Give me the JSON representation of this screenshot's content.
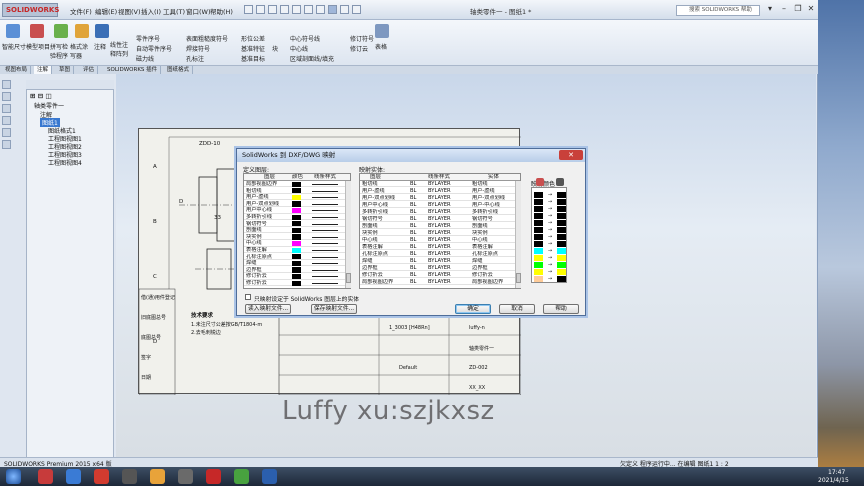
{
  "app": {
    "logo_text": "SOLIDWORKS",
    "menu": [
      "文件(F)",
      "编辑(E)",
      "视图(V)",
      "插入(I)",
      "工具(T)",
      "窗口(W)",
      "帮助(H)"
    ],
    "window_title": "轴类零件一 - 图纸1 *",
    "search_placeholder": "搜索 SOLIDWORKS 帮助"
  },
  "ribbon": {
    "big_buttons": [
      "智能尺寸",
      "模型项目",
      "拼写检验程序",
      "格式涂写器",
      "注释"
    ],
    "col1": [
      "线性注释阵列",
      "零件序号",
      "自动零件序号",
      "磁力线"
    ],
    "col2": [
      "表面粗糙度符号",
      "焊接符号",
      "孔标注"
    ],
    "col3": [
      "形位公差",
      "基准特征",
      "基准目标"
    ],
    "col4": [
      "中心符号线",
      "中心线",
      "区域剖面线/填充"
    ],
    "col5": [
      "修订符号",
      "修订云"
    ],
    "col6": [
      "表格"
    ],
    "col7": [
      "块"
    ]
  },
  "tabs": [
    "视图布局",
    "注解",
    "草图",
    "评估",
    "SOLIDWORKS 插件",
    "图纸格式"
  ],
  "tree": {
    "root": "轴类零件一",
    "items": [
      "注解",
      "图纸1",
      "图纸格式1",
      "工程图视图1",
      "工程图视图2",
      "工程图视图3",
      "工程图视图4"
    ]
  },
  "drawing": {
    "view_label": "ZDD-10",
    "notes": [
      "技术要求",
      "1.未注尺寸公差按GB/T1804-m",
      "2.去毛刺锐边"
    ],
    "left_labels": [
      "借(通)用件登记",
      "旧底图总号",
      "底图总号",
      "签字",
      "日期"
    ],
    "title_block": [
      "1_3003 [H48Rn]",
      "luffy-n",
      "轴类零件一",
      "ZD-002",
      "Default",
      "XX_XX"
    ],
    "ruler_letters": [
      "A",
      "B",
      "C",
      "D"
    ],
    "dim_a": "D",
    "dim_b": "33"
  },
  "dialog": {
    "title": "SolidWorks 到 DXF/DWG 映射",
    "close": "✕",
    "left_label": "定义图层:",
    "right_label": "映射实体:",
    "color_label": "映射颜色",
    "left_cols": [
      "图层",
      "颜色",
      "线条样式"
    ],
    "right_cols": [
      "图层",
      "",
      "线条样式",
      "实体"
    ],
    "left_rows": [
      {
        "name": "局部视图边界",
        "color": "#000000"
      },
      {
        "name": "粗切线",
        "color": "#000000"
      },
      {
        "name": "用户-虚线",
        "color": "#ffff00"
      },
      {
        "name": "用户-双点划线",
        "color": "#000000"
      },
      {
        "name": "用户中心线",
        "color": "#ff00ff"
      },
      {
        "name": "多转折引线",
        "color": "#000000"
      },
      {
        "name": "钢切符号",
        "color": "#000000"
      },
      {
        "name": "剖面线",
        "color": "#000000"
      },
      {
        "name": "块实例",
        "color": "#000000"
      },
      {
        "name": "中心线",
        "color": "#ff00ff"
      },
      {
        "name": "表格注解",
        "color": "#00ffff"
      },
      {
        "name": "孔标注原点",
        "color": "#000000"
      },
      {
        "name": "焊缝",
        "color": "#000000"
      },
      {
        "name": "边界框",
        "color": "#000000"
      },
      {
        "name": "修订折云",
        "color": "#000000"
      },
      {
        "name": "修订折云",
        "color": "#000000"
      }
    ],
    "right_rows": [
      {
        "layer": "粗切线",
        "sw": "BL",
        "style": "BYLAYER",
        "entity": "粗切线"
      },
      {
        "layer": "用户-虚线",
        "sw": "BL",
        "style": "BYLAYER",
        "entity": "用户-虚线"
      },
      {
        "layer": "用户-双点划线",
        "sw": "BL",
        "style": "BYLAYER",
        "entity": "用户-双点划线"
      },
      {
        "layer": "用户中心线",
        "sw": "BL",
        "style": "BYLAYER",
        "entity": "用户-中心线"
      },
      {
        "layer": "多转折引线",
        "sw": "BL",
        "style": "BYLAYER",
        "entity": "多转折引线"
      },
      {
        "layer": "钢切符号",
        "sw": "BL",
        "style": "BYLAYER",
        "entity": "钢切符号"
      },
      {
        "layer": "剖面线",
        "sw": "BL",
        "style": "BYLAYER",
        "entity": "剖面线"
      },
      {
        "layer": "块实例",
        "sw": "BL",
        "style": "BYLAYER",
        "entity": "块实例"
      },
      {
        "layer": "中心线",
        "sw": "BL",
        "style": "BYLAYER",
        "entity": "中心线"
      },
      {
        "layer": "表格注解",
        "sw": "BL",
        "style": "BYLAYER",
        "entity": "表格注解"
      },
      {
        "layer": "孔标注原点",
        "sw": "BL",
        "style": "BYLAYER",
        "entity": "孔标注原点"
      },
      {
        "layer": "焊缝",
        "sw": "BL",
        "style": "BYLAYER",
        "entity": "焊缝"
      },
      {
        "layer": "边界框",
        "sw": "BL",
        "style": "BYLAYER",
        "entity": "边界框"
      },
      {
        "layer": "修订折云",
        "sw": "BL",
        "style": "BYLAYER",
        "entity": "修订折云"
      },
      {
        "layer": "局部视图边界",
        "sw": "BL",
        "style": "BYLAYER",
        "entity": "局部视图边界"
      }
    ],
    "color_rows": [
      {
        "left": "#000000",
        "right": "#000000"
      },
      {
        "left": "#000000",
        "right": "#000000"
      },
      {
        "left": "#000000",
        "right": "#000000"
      },
      {
        "left": "#000000",
        "right": "#000000"
      },
      {
        "left": "#000000",
        "right": "#000000"
      },
      {
        "left": "#000000",
        "right": "#000000"
      },
      {
        "left": "#000000",
        "right": "#000000"
      },
      {
        "left": "#000000",
        "right": "#000000"
      },
      {
        "left": "#00ffff",
        "right": "#00ffff"
      },
      {
        "left": "#ffff00",
        "right": "#ffff00"
      },
      {
        "left": "#00ff00",
        "right": "#00ff00"
      },
      {
        "left": "#ffff00",
        "right": "#ffff00"
      },
      {
        "left": "#ffcc99",
        "right": "#000000"
      }
    ],
    "arrow": "→",
    "checkbox_label": "只映射设定于 SolidWorks 图层上的实体",
    "btn_load": "读入映射文件...",
    "btn_save": "保存映射文件...",
    "btn_ok": "确定",
    "btn_cancel": "取消",
    "btn_help": "帮助"
  },
  "watermark": "Luffy xu:szjkxsz",
  "status": {
    "left": "SOLIDWORKS Premium 2015 x64 版",
    "right": "欠定义   程序运行中...   在编辑 图纸1   1 : 2"
  },
  "taskbar": {
    "time": "17:47",
    "date": "2021/4/15"
  },
  "colors": {
    "accent": "#c62828",
    "dialog_border": "#4f6d99"
  }
}
